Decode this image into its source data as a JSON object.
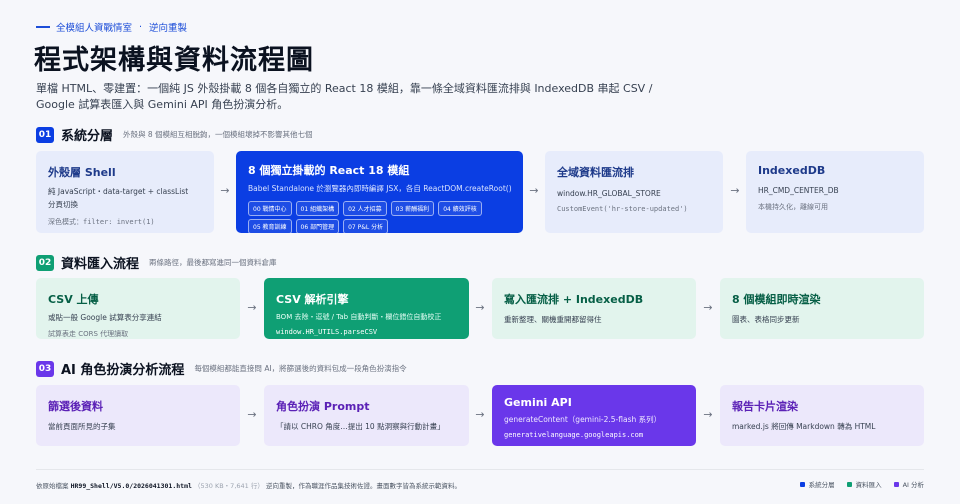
{
  "header": {
    "eyebrow_org": "全模組人資戰情室",
    "eyebrow_sep": "·",
    "eyebrow_tag": "逆向重製",
    "title": "程式架構與資料流程圖",
    "intro": "單檔 HTML、零建置：一個純 JS 外殼掛載 8 個各自獨立的 React 18 模組，靠一條全域資料匯流排與 IndexedDB 串起 CSV / Google 試算表匯入與 Gemini API 角色扮演分析。"
  },
  "colors": {
    "blue": "#0b3ee3",
    "green": "#0f9f74",
    "purple": "#6a37ea"
  },
  "sections": [
    {
      "num": "01",
      "title": "系統分層",
      "desc": "外殼與 8 個模組互相脫鉤，一個模組壞掉不影響其他七個",
      "cards": [
        {
          "title": "外殼層 Shell",
          "line1": "純 JavaScript・data-target + classList",
          "line1b": "分頁切換",
          "line2": "深色模式：filter: invert(1)"
        },
        {
          "title": "8 個獨立掛載的 React 18 模組",
          "line1": "Babel Standalone 於瀏覽器內即時編譯 JSX，各自 ReactDOM.createRoot()",
          "chips": [
            "00 戰情中心",
            "01 組織架構",
            "02 人才招募",
            "03 薪酬福利",
            "04 績效評核",
            "05 教育訓練",
            "06 部門管理",
            "07 P&L 分析"
          ]
        },
        {
          "title": "全域資料匯流排",
          "line1": "window.HR_GLOBAL_STORE",
          "line2": "CustomEvent('hr-store-updated')"
        },
        {
          "title": "IndexedDB",
          "line1": "HR_CMD_CENTER_DB",
          "line2": "本機持久化，離線可用"
        }
      ]
    },
    {
      "num": "02",
      "title": "資料匯入流程",
      "desc": "兩條路徑，最後都寫進同一個資料倉庫",
      "cards": [
        {
          "title": "CSV 上傳",
          "line1": "或貼一般 Google 試算表分享連結",
          "line2": "試算表走 CORS 代理讀取"
        },
        {
          "title": "CSV 解析引擎",
          "line1": "BOM 去除・逗號 / Tab 自動判斷・欄位錯位自動校正",
          "line2": "window.HR_UTILS.parseCSV"
        },
        {
          "title": "寫入匯流排 + IndexedDB",
          "line1": "重新整理、關機重開都留得住"
        },
        {
          "title": "8 個模組即時渲染",
          "line1": "圖表、表格同步更新"
        }
      ]
    },
    {
      "num": "03",
      "title": "AI 角色扮演分析流程",
      "desc": "每個模組都能直接問 AI，將篩選後的資料包成一段角色扮演指令",
      "cards": [
        {
          "title": "篩選後資料",
          "line1": "當前頁面所見的子集"
        },
        {
          "title": "角色扮演 Prompt",
          "line1": "「請以 CHRO 角度…提出 10 點洞察與行動計畫」"
        },
        {
          "title": "Gemini API",
          "line1": "generateContent（gemini-2.5-flash 系列）",
          "line2": "generativelanguage.googleapis.com"
        },
        {
          "title": "報告卡片渲染",
          "line1": "marked.js 將回傳 Markdown 轉為 HTML"
        }
      ]
    }
  ],
  "footer": {
    "prefix": "依原始檔案",
    "file": "HR99_Shell/V5.0/2026041301.html",
    "size": "（530 KB・7,641 行）",
    "note": "逆向重製，作為職涯作品集技術佐證。畫面數字皆為系統示範資料。",
    "legend": [
      {
        "label": "系統分層",
        "color": "#0b3ee3"
      },
      {
        "label": "資料匯入",
        "color": "#0f9f74"
      },
      {
        "label": "AI 分析",
        "color": "#6a37ea"
      }
    ]
  },
  "arrow_glyph": "→"
}
